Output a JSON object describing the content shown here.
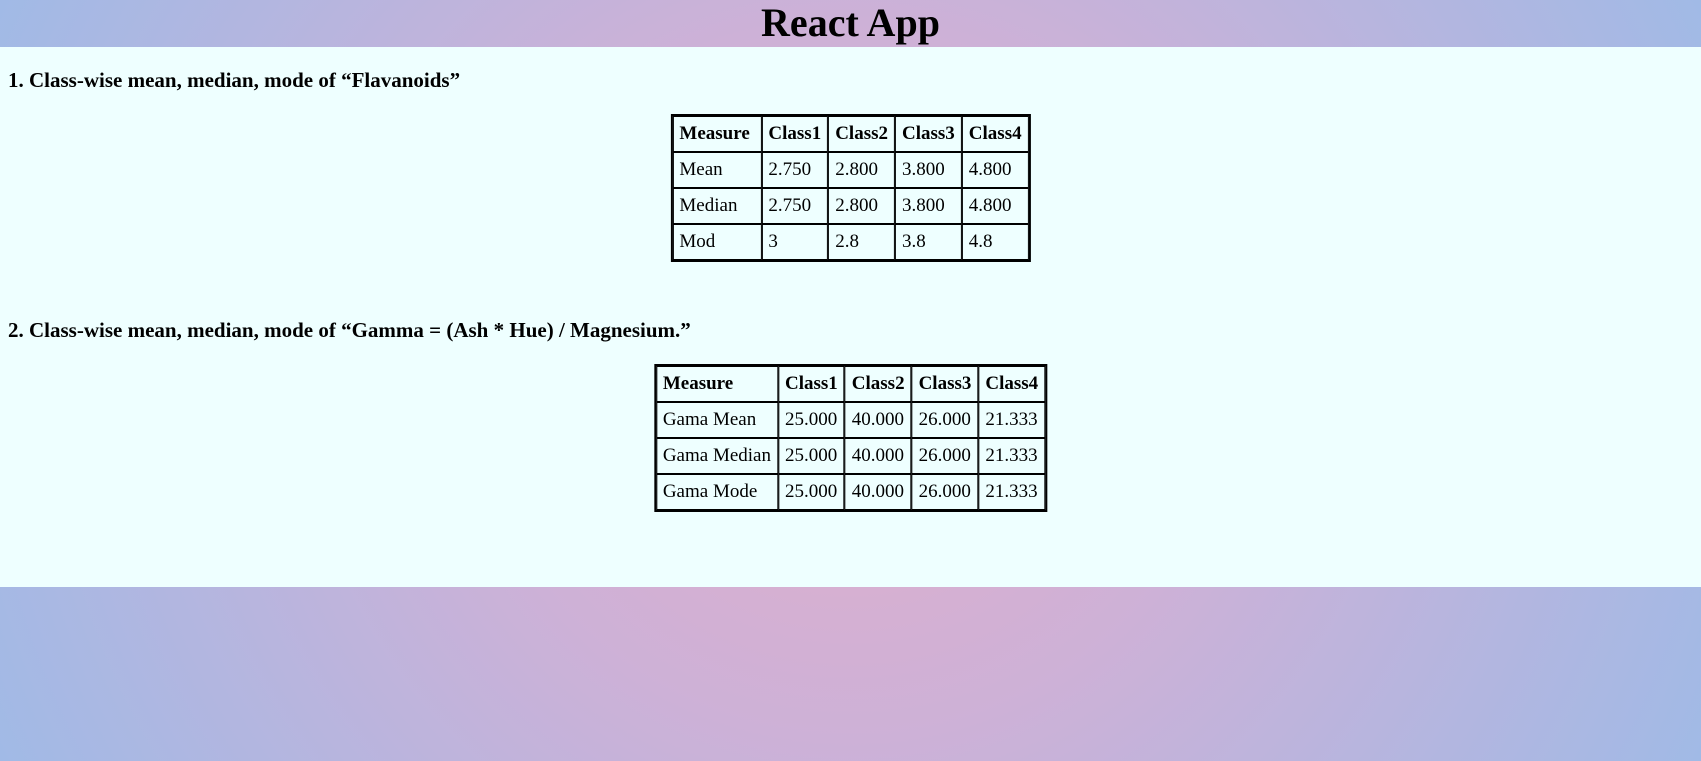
{
  "app": {
    "title": "React App"
  },
  "sections": [
    {
      "heading": "1. Class-wise mean, median, mode of “Flavanoids”",
      "table": {
        "headers": [
          "Measure",
          "Class1",
          "Class2",
          "Class3",
          "Class4"
        ],
        "rows": [
          [
            "Mean",
            "2.750",
            "2.800",
            "3.800",
            "4.800"
          ],
          [
            "Median",
            "2.750",
            "2.800",
            "3.800",
            "4.800"
          ],
          [
            "Mod",
            "3",
            "2.8",
            "3.8",
            "4.8"
          ]
        ]
      }
    },
    {
      "heading": "2. Class-wise mean, median, mode of “Gamma = (Ash * Hue) / Magnesium.”",
      "table": {
        "headers": [
          "Measure",
          "Class1",
          "Class2",
          "Class3",
          "Class4"
        ],
        "rows": [
          [
            "Gama Mean",
            "25.000",
            "40.000",
            "26.000",
            "21.333"
          ],
          [
            "Gama Median",
            "25.000",
            "40.000",
            "26.000",
            "21.333"
          ],
          [
            "Gama Mode",
            "25.000",
            "40.000",
            "26.000",
            "21.333"
          ]
        ]
      }
    }
  ],
  "colors": {
    "content_background": "#eeffff",
    "gradient_center": "#e2aecb",
    "gradient_edge": "#a0bae6",
    "text": "#000000"
  }
}
